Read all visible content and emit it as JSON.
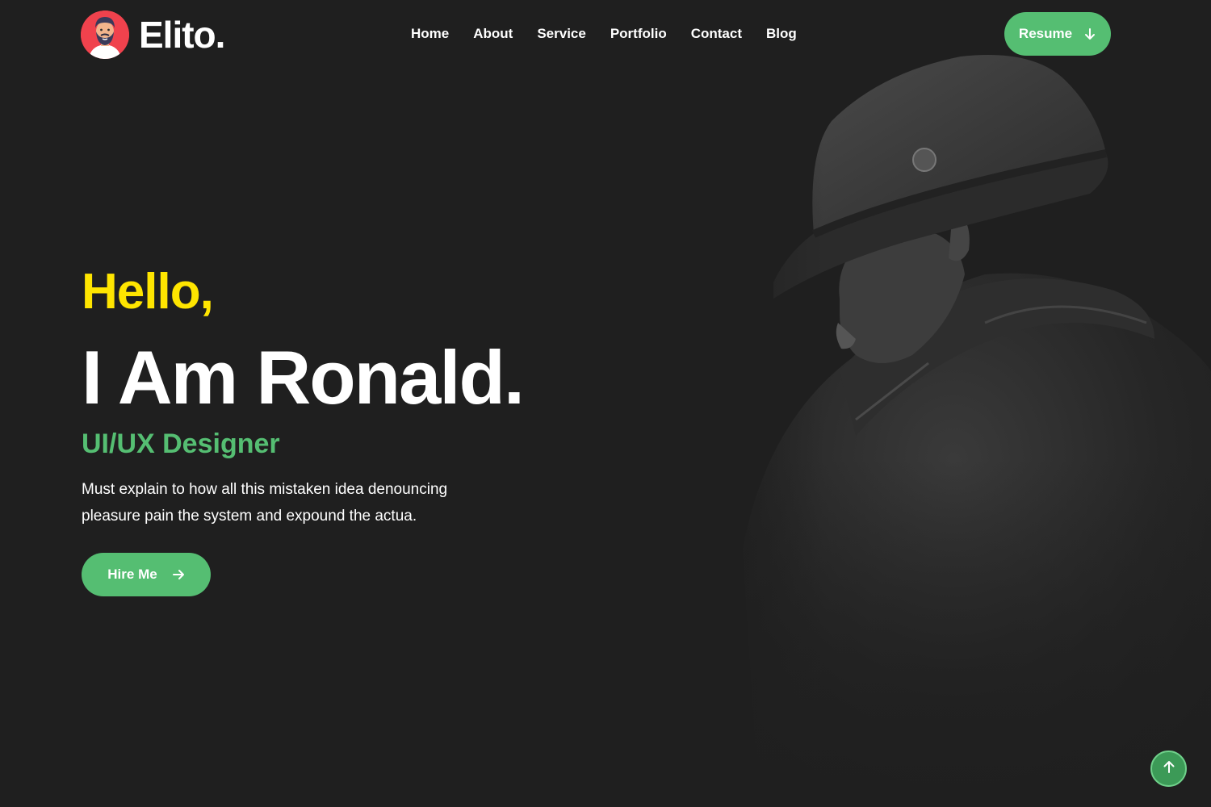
{
  "brand": {
    "name": "Elito",
    "dot": "."
  },
  "nav": {
    "items": [
      {
        "label": "Home"
      },
      {
        "label": "About"
      },
      {
        "label": "Service"
      },
      {
        "label": "Portfolio"
      },
      {
        "label": "Contact"
      },
      {
        "label": "Blog"
      }
    ]
  },
  "header": {
    "resume_label": "Resume",
    "resume_icon": "arrow-down-icon"
  },
  "hero": {
    "greeting": "Hello,",
    "name": "I Am Ronald.",
    "role": "UI/UX Designer",
    "description": "Must explain to how all this mistaken idea denouncing pleasure pain the system and expound the actua.",
    "hire_label": "Hire Me",
    "hire_icon": "arrow-right-icon"
  },
  "scroll_top": {
    "icon": "arrow-up-icon"
  },
  "colors": {
    "background": "#1f1f1f",
    "accent_green": "#55be72",
    "greeting_yellow": "#ffe500",
    "avatar_red": "#f0424d"
  }
}
